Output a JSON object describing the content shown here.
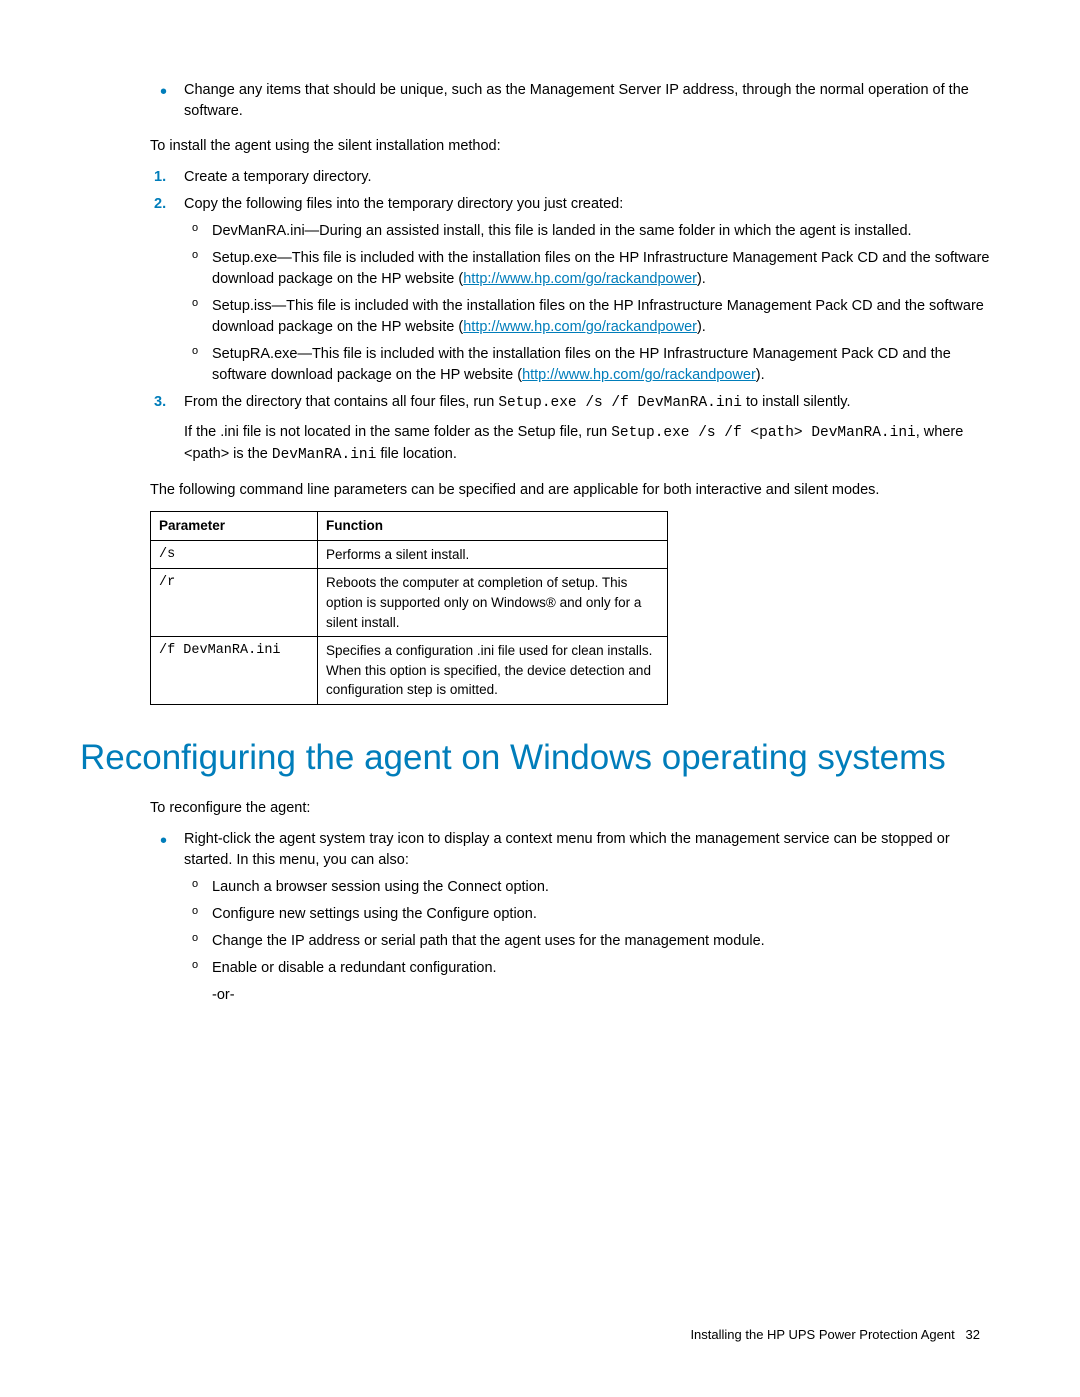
{
  "top_bullet": "Change any items that should be unique, such as the Management Server IP address, through the normal operation of the software.",
  "install_intro": "To install the agent using the silent installation method:",
  "steps": {
    "s1_num": "1.",
    "s1": "Create a temporary directory.",
    "s2_num": "2.",
    "s2": "Copy the following files into the temporary directory you just created:",
    "s2_sub": {
      "a": "DevManRA.ini—During an assisted install, this file is landed in the same folder in which the agent is installed.",
      "b_pre": "Setup.exe—This file is included with the installation files on the HP Infrastructure Management Pack CD and the software download package on the HP website (",
      "b_link": "http://www.hp.com/go/rackandpower",
      "b_post": ").",
      "c_pre": "Setup.iss—This file is included with the installation files on the HP Infrastructure Management Pack CD and the software download package on the HP website (",
      "c_link": "http://www.hp.com/go/rackandpower",
      "c_post": ").",
      "d_pre": "SetupRA.exe—This file is included with the installation files on the HP Infrastructure Management Pack CD and the software download package on the HP website (",
      "d_link": "http://www.hp.com/go/rackandpower",
      "d_post": ")."
    },
    "s3_num": "3.",
    "s3_pre": "From the directory that contains all four files, run ",
    "s3_cmd": "Setup.exe /s /f DevManRA.ini",
    "s3_post": " to install silently.",
    "s3_extra_pre": "If the .ini file is not located in the same folder as the Setup file, run ",
    "s3_extra_cmd1": "Setup.exe /s /f <path> DevManRA.ini",
    "s3_extra_mid": ", where <path> is the ",
    "s3_extra_cmd2": "DevManRA.ini",
    "s3_extra_post": " file location."
  },
  "table_intro": "The following command line parameters can be specified and are applicable for both interactive and silent modes.",
  "table": {
    "h1": "Parameter",
    "h2": "Function",
    "r1p": "/s",
    "r1f": "Performs a silent install.",
    "r2p": "/r",
    "r2f": "Reboots the computer at completion of setup. This option is supported only on Windows® and only for a silent install.",
    "r3p": "/f DevManRA.ini",
    "r3f": "Specifies a configuration .ini file used for clean installs. When this option is specified, the device detection and configuration step is omitted."
  },
  "heading": "Reconfiguring the agent on Windows operating systems",
  "reconf_intro": "To reconfigure the agent:",
  "reconf_bullet": "Right-click the agent system tray icon to display a context menu from which the management service can be stopped or started. In this menu, you can also:",
  "reconf_sub": {
    "a": "Launch a browser session using the Connect option.",
    "b": "Configure new settings using the Configure option.",
    "c": "Change the IP address or serial path that the agent uses for the management module.",
    "d": "Enable or disable a redundant configuration."
  },
  "or": "-or-",
  "footer_text": "Installing the HP UPS Power Protection Agent",
  "footer_page": "32"
}
